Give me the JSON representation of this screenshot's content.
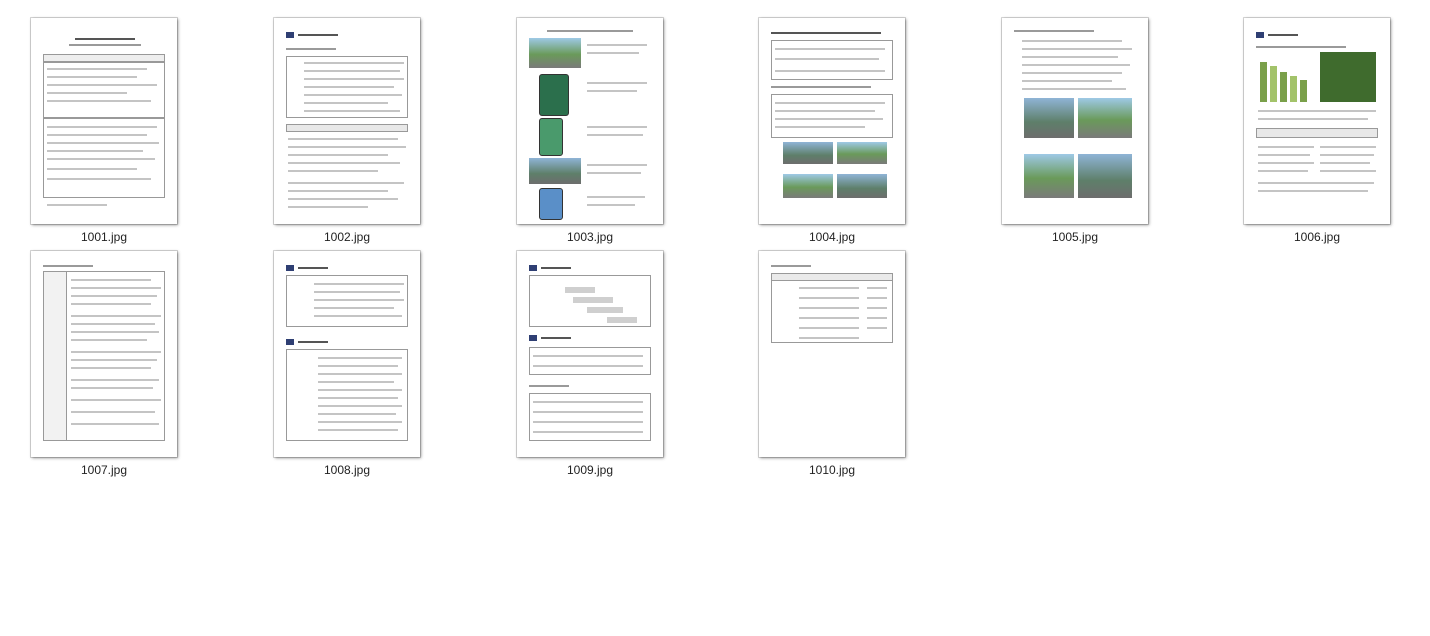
{
  "files": [
    {
      "name": "1001.jpg",
      "icon": "document-thumbnail-icon"
    },
    {
      "name": "1002.jpg",
      "icon": "document-thumbnail-icon"
    },
    {
      "name": "1003.jpg",
      "icon": "document-thumbnail-icon"
    },
    {
      "name": "1004.jpg",
      "icon": "document-thumbnail-icon"
    },
    {
      "name": "1005.jpg",
      "icon": "document-thumbnail-icon"
    },
    {
      "name": "1006.jpg",
      "icon": "document-thumbnail-icon"
    },
    {
      "name": "1007.jpg",
      "icon": "document-thumbnail-icon"
    },
    {
      "name": "1008.jpg",
      "icon": "document-thumbnail-icon"
    },
    {
      "name": "1009.jpg",
      "icon": "document-thumbnail-icon"
    },
    {
      "name": "1010.jpg",
      "icon": "document-thumbnail-icon"
    }
  ]
}
